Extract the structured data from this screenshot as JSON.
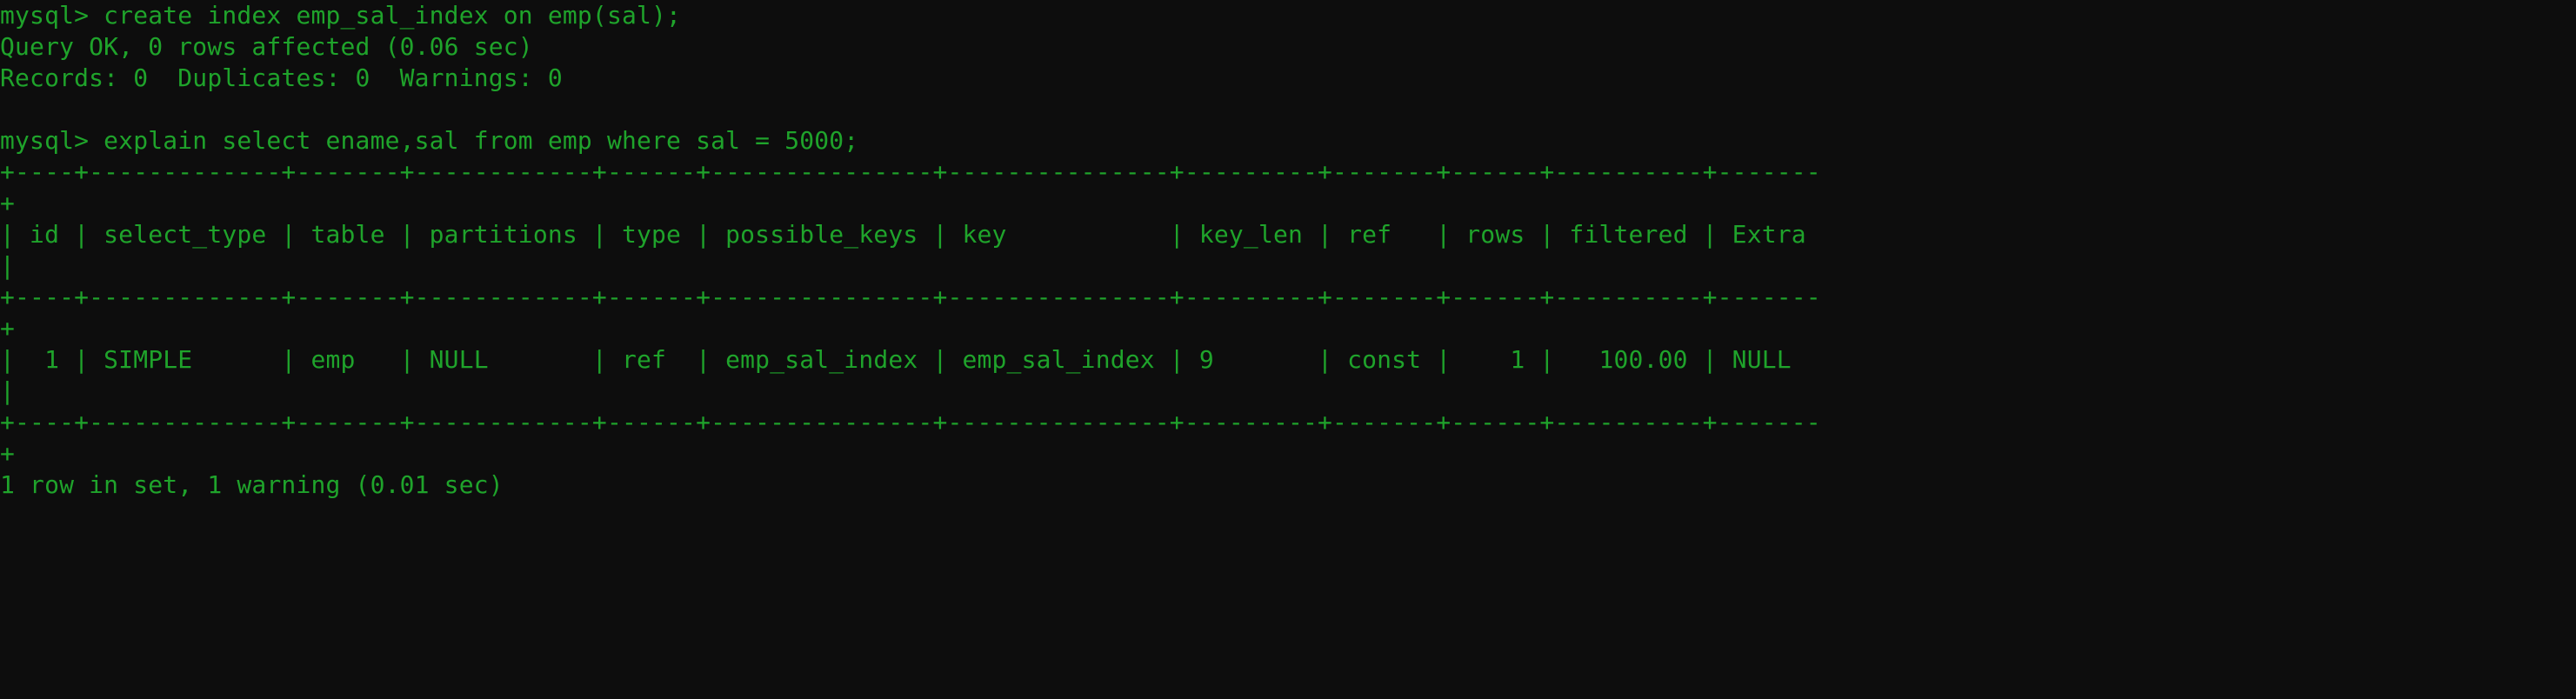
{
  "terminal": {
    "window_title": "mysql",
    "background_color": "#0d0d0d",
    "foreground_color": "#1fa32b",
    "prompt": "mysql>",
    "columns": 174,
    "lines": [
      {
        "id": "line-1",
        "kind": "command",
        "text": "mysql> create index emp_sal_index on emp(sal);"
      },
      {
        "id": "line-2",
        "kind": "status",
        "text": "Query OK, 0 rows affected (0.06 sec)"
      },
      {
        "id": "line-3",
        "kind": "status",
        "text": "Records: 0  Duplicates: 0  Warnings: 0"
      },
      {
        "id": "line-4",
        "kind": "blank",
        "text": ""
      },
      {
        "id": "line-5",
        "kind": "command",
        "text": "mysql> explain select ename,sal from emp where sal = 5000;"
      },
      {
        "id": "line-6",
        "kind": "separator",
        "text": "+----+-------------+-------+------------+------+---------------+---------------+---------+-------+------+----------+-------"
      },
      {
        "id": "line-7",
        "kind": "separator-wrap",
        "text": "+"
      },
      {
        "id": "line-8",
        "kind": "header",
        "text": "| id | select_type | table | partitions | type | possible_keys | key           | key_len | ref   | rows | filtered | Extra"
      },
      {
        "id": "line-9",
        "kind": "header-wrap",
        "text": "|"
      },
      {
        "id": "line-10",
        "kind": "separator",
        "text": "+----+-------------+-------+------------+------+---------------+---------------+---------+-------+------+----------+-------"
      },
      {
        "id": "line-11",
        "kind": "separator-wrap",
        "text": "+"
      },
      {
        "id": "line-12",
        "kind": "row",
        "text": "|  1 | SIMPLE      | emp   | NULL       | ref  | emp_sal_index | emp_sal_index | 9       | const |    1 |   100.00 | NULL "
      },
      {
        "id": "line-13",
        "kind": "row-wrap",
        "text": "|"
      },
      {
        "id": "line-14",
        "kind": "separator",
        "text": "+----+-------------+-------+------------+------+---------------+---------------+---------+-------+------+----------+-------"
      },
      {
        "id": "line-15",
        "kind": "separator-wrap",
        "text": "+"
      },
      {
        "id": "line-16",
        "kind": "status",
        "text": "1 row in set, 1 warning (0.01 sec)"
      }
    ],
    "commands": [
      {
        "id": "cmd-create-index",
        "sql": "create index emp_sal_index on emp(sal);"
      },
      {
        "id": "cmd-explain",
        "sql": "explain select ename,sal from emp where sal = 5000;"
      }
    ],
    "create_index_result": {
      "status": "Query OK, 0 rows affected (0.06 sec)",
      "rows_affected": "0",
      "duration": "0.06 sec",
      "records": "0",
      "duplicates": "0",
      "warnings": "0"
    },
    "explain_result": {
      "columns": [
        "id",
        "select_type",
        "table",
        "partitions",
        "type",
        "possible_keys",
        "key",
        "key_len",
        "ref",
        "rows",
        "filtered",
        "Extra"
      ],
      "rows": [
        {
          "id": "1",
          "select_type": "SIMPLE",
          "table": "emp",
          "partitions": "NULL",
          "type": "ref",
          "possible_keys": "emp_sal_index",
          "key": "emp_sal_index",
          "key_len": "9",
          "ref": "const",
          "rows": "1",
          "filtered": "100.00",
          "Extra": "NULL"
        }
      ],
      "footer": "1 row in set, 1 warning (0.01 sec)",
      "row_count": "1",
      "warning_count": "1",
      "duration": "0.01 sec"
    }
  }
}
